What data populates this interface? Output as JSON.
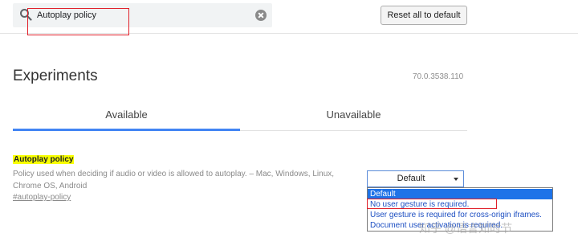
{
  "search": {
    "value": "Autoplay policy"
  },
  "toolbar": {
    "reset_label": "Reset all to default"
  },
  "header": {
    "title": "Experiments",
    "version": "70.0.3538.110"
  },
  "tabs": [
    {
      "label": "Available",
      "active": true
    },
    {
      "label": "Unavailable",
      "active": false
    }
  ],
  "experiment": {
    "name": "Autoplay policy",
    "description": "Policy used when deciding if audio or video is allowed to autoplay. – Mac, Windows, Linux, Chrome OS, Android",
    "link": "#autoplay-policy",
    "selected_value": "Default",
    "options": [
      "Default",
      "No user gesture is required.",
      "User gesture is required for cross-origin iframes.",
      "Document user activation is required."
    ]
  },
  "watermark": "知乎 @语言知时节",
  "colors": {
    "accent": "#4285f4",
    "highlight": "#f8ff00",
    "annotation": "#e0202a",
    "option_selected": "#1e73e8"
  },
  "icons": [
    "search-icon",
    "close-icon",
    "chevron-down-icon"
  ]
}
